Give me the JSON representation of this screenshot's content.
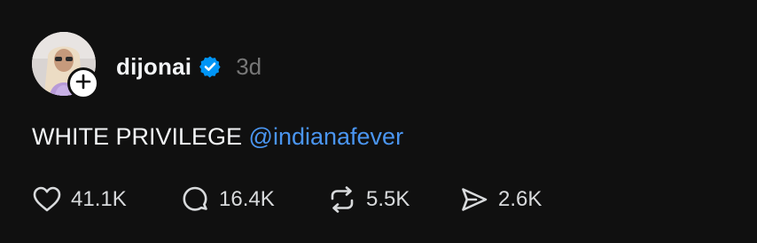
{
  "post": {
    "username": "dijonai",
    "verified": true,
    "timestamp": "3d",
    "text_prefix": "WHITE PRIVILEGE ",
    "mention": "@indianafever",
    "stats": {
      "likes": "41.1K",
      "replies": "16.4K",
      "reposts": "5.5K",
      "shares": "2.6K"
    }
  },
  "colors": {
    "background": "#101010",
    "text": "#f3f5f7",
    "muted": "#777777",
    "link": "#4a95f0",
    "verified_badge": "#0095f6"
  },
  "icons": [
    "avatar",
    "plus-icon",
    "verified-badge-icon",
    "heart-icon",
    "comment-icon",
    "repost-icon",
    "share-icon"
  ]
}
